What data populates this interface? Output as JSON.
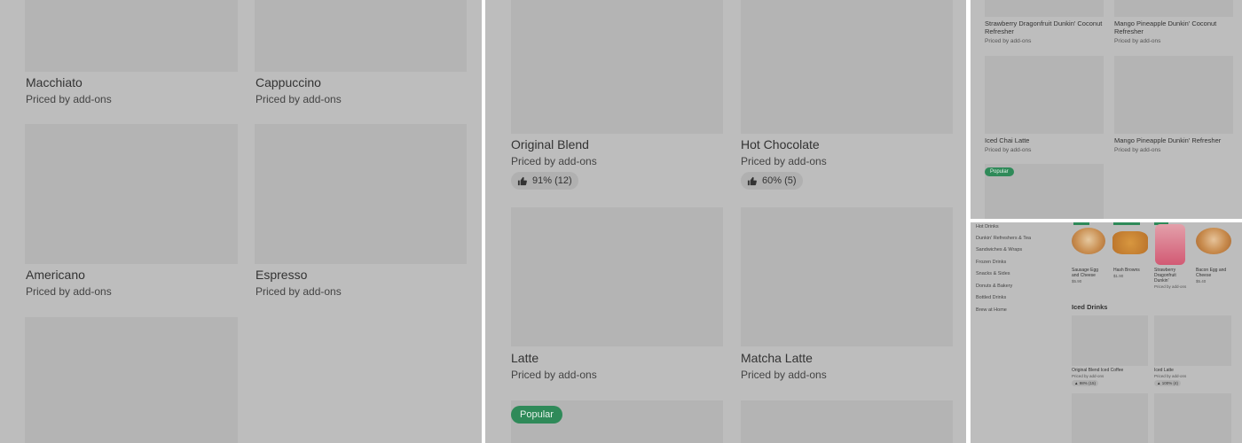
{
  "panel1": {
    "items": [
      {
        "name": "Macchiato",
        "price": "Priced by add-ons"
      },
      {
        "name": "Cappuccino",
        "price": "Priced by add-ons"
      },
      {
        "name": "Americano",
        "price": "Priced by add-ons"
      },
      {
        "name": "Espresso",
        "price": "Priced by add-ons"
      }
    ]
  },
  "panel2": {
    "items": [
      {
        "name": "Original Blend",
        "price": "Priced by add-ons",
        "rating": "91% (12)"
      },
      {
        "name": "Hot Chocolate",
        "price": "Priced by add-ons",
        "rating": "60% (5)"
      },
      {
        "name": "Latte",
        "price": "Priced by add-ons"
      },
      {
        "name": "Matcha Latte",
        "price": "Priced by add-ons"
      }
    ],
    "badge": "Popular"
  },
  "panel3": {
    "items": [
      {
        "name": "Strawberry Dragonfruit Dunkin' Coconut Refresher",
        "price": "Priced by add-ons"
      },
      {
        "name": "Mango Pineapple Dunkin' Coconut Refresher",
        "price": "Priced by add-ons"
      },
      {
        "name": "Iced Chai Latte",
        "price": "Priced by add-ons"
      },
      {
        "name": "Mango Pineapple Dunkin' Refresher",
        "price": "Priced by add-ons"
      }
    ],
    "badge": "Popular"
  },
  "panel4": {
    "nav": [
      "Hot Drinks",
      "Dunkin' Refreshers & Tea",
      "Sandwiches & Wraps",
      "Frozen Drinks",
      "Snacks & Sides",
      "Donuts & Bakery",
      "Bottled Drinks",
      "Brew at Home"
    ],
    "popular": [
      {
        "name": "Sausage Egg and Cheese",
        "price": "$5.90"
      },
      {
        "name": "Hash Browns",
        "price": "$1.90"
      },
      {
        "name": "Strawberry Dragonfruit Dunkin'",
        "price": "Priced by add-ons"
      },
      {
        "name": "Bacon Egg and Cheese",
        "price": "$5.40"
      }
    ],
    "section_title": "Iced Drinks",
    "iced": [
      {
        "name": "Original Blend Iced Coffee",
        "price": "Priced by add-ons",
        "rating": "98% (15)"
      },
      {
        "name": "Iced Latte",
        "price": "Priced by add-ons",
        "rating": "100% (4)"
      }
    ]
  },
  "colors": {
    "overlay": "#bdbdbd",
    "placeholder": "#b4b4b4",
    "badge": "#2f8a59"
  },
  "icons": {
    "rating": "thumbs-up-icon"
  }
}
